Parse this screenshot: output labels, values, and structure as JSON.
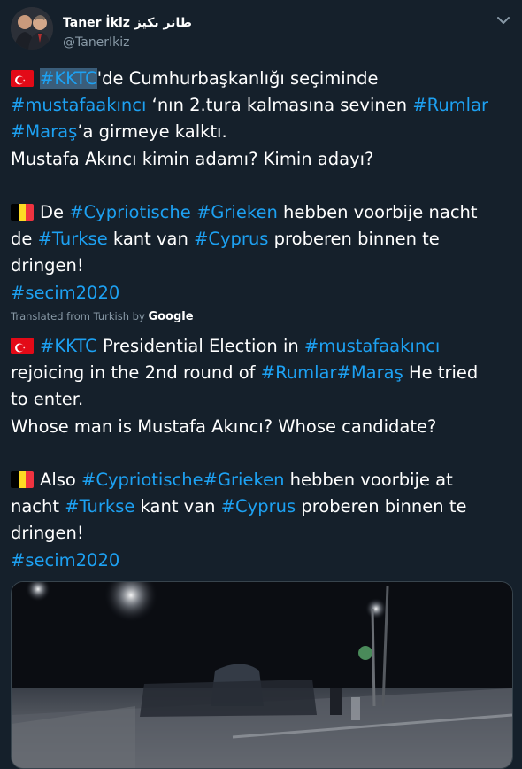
{
  "user": {
    "display_name": "Taner İkiz",
    "display_name_arabic": "طانر ىكيز",
    "handle": "@TanerIkiz"
  },
  "original": {
    "lines": [
      [
        {
          "flag": "tr"
        },
        {
          "t": "#KKTC",
          "tag": true,
          "sel": true
        },
        {
          "t": "'de Cumhurbaşkanlığı seçiminde"
        }
      ],
      [
        {
          "t": "#mustafaakıncı",
          "tag": true
        },
        {
          "t": " ‘nın 2.tura kalmasına sevinen "
        },
        {
          "t": "#Rumlar",
          "tag": true
        }
      ],
      [
        {
          "t": "#Maraş",
          "tag": true
        },
        {
          "t": "’a girmeye kalktı."
        }
      ],
      [
        {
          "t": "Mustafa Akıncı kimin adamı? Kimin adayı?"
        }
      ],
      [],
      [
        {
          "flag": "be"
        },
        {
          "t": "De "
        },
        {
          "t": "#Cypriotische",
          "tag": true
        },
        {
          "t": " "
        },
        {
          "t": "#Grieken",
          "tag": true
        },
        {
          "t": " hebben voorbije nacht"
        }
      ],
      [
        {
          "t": "de "
        },
        {
          "t": "#Turkse",
          "tag": true
        },
        {
          "t": " kant van "
        },
        {
          "t": "#Cyprus",
          "tag": true
        },
        {
          "t": " proberen binnen te"
        }
      ],
      [
        {
          "t": "dringen!"
        }
      ],
      [
        {
          "t": "#secim2020",
          "tag": true
        }
      ]
    ]
  },
  "translation": {
    "prefix": "Translated from Turkish by",
    "brand": "Google",
    "lines": [
      [
        {
          "flag": "tr"
        },
        {
          "t": "#KKTC",
          "tag": true
        },
        {
          "t": " Presidential Election in "
        },
        {
          "t": "#mustafaakıncı",
          "tag": true
        }
      ],
      [
        {
          "t": "rejoicing in the 2nd round of "
        },
        {
          "t": "#Rumlar",
          "tag": true
        },
        {
          "t": "#Maraş",
          "tag": true
        },
        {
          "t": " He tried"
        }
      ],
      [
        {
          "t": "to enter."
        }
      ],
      [
        {
          "t": " Whose man is Mustafa Akıncı? Whose candidate?"
        }
      ],
      [],
      [
        {
          "flag": "be"
        },
        {
          "t": "Also "
        },
        {
          "t": "#Cypriotische",
          "tag": true
        },
        {
          "t": "#Grieken",
          "tag": true
        },
        {
          "t": " hebben voorbije at"
        }
      ],
      [
        {
          "t": "nacht "
        },
        {
          "t": "#Turkse",
          "tag": true
        },
        {
          "t": " kant van "
        },
        {
          "t": "#Cyprus",
          "tag": true
        },
        {
          "t": " proberen binnen te"
        }
      ],
      [
        {
          "t": "dringen!"
        }
      ],
      [
        {
          "t": "#secim2020",
          "tag": true
        }
      ]
    ]
  },
  "media": {
    "type": "video-still",
    "scene": "night street"
  },
  "colors": {
    "background": "#15202b",
    "link": "#1da1f2",
    "muted": "#8899a6"
  },
  "icons": {
    "menu": "chevron-down-icon"
  }
}
